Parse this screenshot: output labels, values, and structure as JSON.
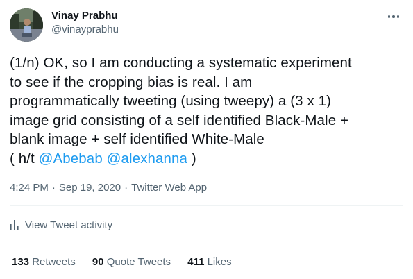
{
  "author": {
    "display_name": "Vinay Prabhu",
    "handle": "@vinayprabhu"
  },
  "tweet": {
    "lines": [
      "(1/n) OK, so I am conducting a systematic experiment",
      "to see if the cropping bias is real. I am",
      "programmatically tweeting (using tweepy) a (3 x 1)",
      "image grid consisting of a self identified Black-Male +",
      "blank image + self identified White-Male"
    ],
    "last_line_prefix": "( h/t ",
    "mention_1": "@Abebab",
    "mention_sep": " ",
    "mention_2": "@alexhanna",
    "last_line_suffix": " )"
  },
  "meta": {
    "time": "4:24 PM",
    "date": "Sep 19, 2020",
    "separator": "·",
    "source": "Twitter Web App"
  },
  "activity": {
    "label": "View Tweet activity",
    "icon": "bar-chart-icon"
  },
  "stats": {
    "retweets_count": "133",
    "retweets_label": "Retweets",
    "quotes_count": "90",
    "quotes_label": "Quote Tweets",
    "likes_count": "411",
    "likes_label": "Likes"
  },
  "icons": {
    "more": "more-horizontal-icon",
    "avatar": "profile-photo"
  },
  "colors": {
    "link": "#1d9bf0",
    "secondary_text": "#536471",
    "primary_text": "#0f1419",
    "divider": "#eff3f4"
  }
}
